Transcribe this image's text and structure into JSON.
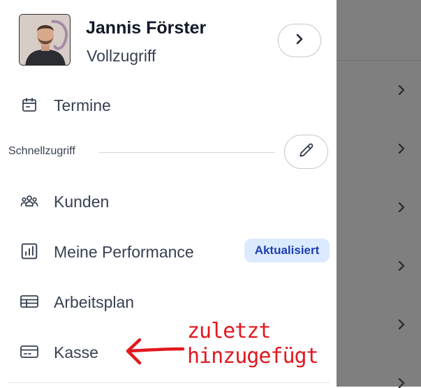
{
  "profile": {
    "name": "Jannis Förster",
    "role": "Vollzugriff",
    "open_icon": "chevron-right-icon"
  },
  "nav": {
    "appointments": {
      "label": "Termine",
      "icon": "calendar-icon"
    },
    "quick_access": {
      "title": "Schnellzugriff",
      "edit_icon": "pencil-icon"
    },
    "items": [
      {
        "label": "Kunden",
        "icon": "users-group-icon"
      },
      {
        "label": "Meine Performance",
        "icon": "bar-chart-icon",
        "badge": "Aktualisiert"
      },
      {
        "label": "Arbeitsplan",
        "icon": "table-schedule-icon"
      },
      {
        "label": "Kasse",
        "icon": "credit-card-icon"
      }
    ]
  },
  "annotation": {
    "line1": "zuletzt",
    "line2": "hinzugefügt",
    "color": "#e0191f"
  },
  "colors": {
    "badge_bg": "#dbeafe",
    "badge_text": "#1e40af",
    "backdrop": "#7f7f7f"
  }
}
